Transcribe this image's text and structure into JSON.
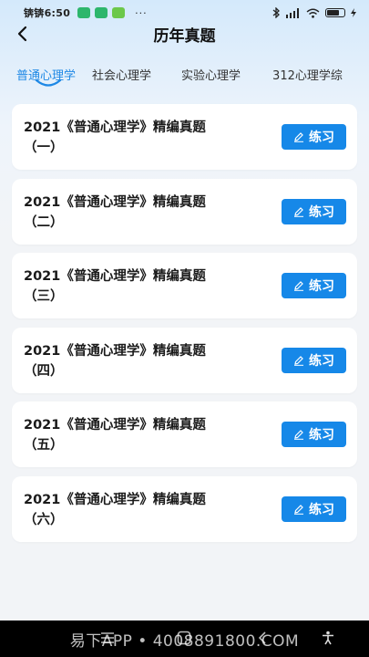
{
  "status_bar": {
    "time": "锛锛6:50",
    "dots": "···",
    "battery_level": 0.75
  },
  "header": {
    "title": "历年真题"
  },
  "tabs": [
    {
      "label": "普通心理学",
      "active": true
    },
    {
      "label": "社会心理学",
      "active": false
    },
    {
      "label": "实验心理学",
      "active": false
    },
    {
      "label": "312心理学综",
      "active": false
    }
  ],
  "papers": [
    {
      "line1": "2021《普通心理学》精编真题",
      "line2": "（一）",
      "button": "练习"
    },
    {
      "line1": "2021《普通心理学》精编真题",
      "line2": "（二）",
      "button": "练习"
    },
    {
      "line1": "2021《普通心理学》精编真题",
      "line2": "（三）",
      "button": "练习"
    },
    {
      "line1": "2021《普通心理学》精编真题",
      "line2": "（四）",
      "button": "练习"
    },
    {
      "line1": "2021《普通心理学》精编真题",
      "line2": "（五）",
      "button": "练习"
    },
    {
      "line1": "2021《普通心理学》精编真题",
      "line2": "（六）",
      "button": "练习"
    }
  ],
  "watermark": "易下APP • 4008891800.COM",
  "colors": {
    "accent": "#1688e8",
    "active_tab": "#1e88e5",
    "background": "#f2f4f7"
  }
}
